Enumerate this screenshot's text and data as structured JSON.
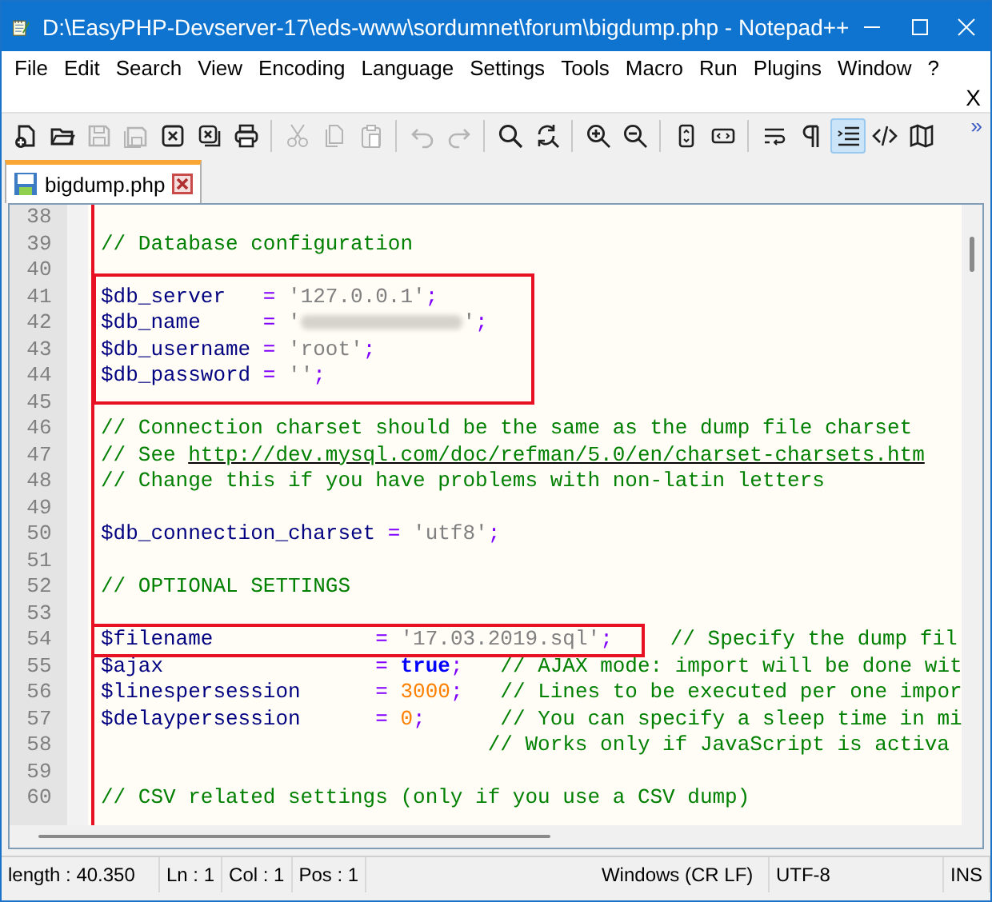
{
  "window": {
    "title": "D:\\EasyPHP-Devserver-17\\eds-www\\sordumnet\\forum\\bigdump.php - Notepad++"
  },
  "menu": [
    {
      "label": "File"
    },
    {
      "label": "Edit"
    },
    {
      "label": "Search"
    },
    {
      "label": "View"
    },
    {
      "label": "Encoding"
    },
    {
      "label": "Language"
    },
    {
      "label": "Settings"
    },
    {
      "label": "Tools"
    },
    {
      "label": "Macro"
    },
    {
      "label": "Run"
    },
    {
      "label": "Plugins"
    },
    {
      "label": "Window"
    },
    {
      "label": "?"
    }
  ],
  "close_document": "X",
  "toolbar": [
    {
      "kind": "button",
      "disabled": false,
      "selected": false
    },
    {
      "kind": "button",
      "disabled": false,
      "selected": false
    },
    {
      "kind": "button",
      "disabled": true,
      "selected": false
    },
    {
      "kind": "button",
      "disabled": true,
      "selected": false
    },
    {
      "kind": "button",
      "disabled": false,
      "selected": false
    },
    {
      "kind": "button",
      "disabled": false,
      "selected": false
    },
    {
      "kind": "button",
      "disabled": false,
      "selected": false
    },
    {
      "kind": "separator"
    },
    {
      "kind": "button",
      "disabled": true,
      "selected": false
    },
    {
      "kind": "button",
      "disabled": true,
      "selected": false
    },
    {
      "kind": "button",
      "disabled": true,
      "selected": false
    },
    {
      "kind": "separator"
    },
    {
      "kind": "button",
      "disabled": true,
      "selected": false
    },
    {
      "kind": "button",
      "disabled": true,
      "selected": false
    },
    {
      "kind": "separator"
    },
    {
      "kind": "button",
      "disabled": false,
      "selected": false
    },
    {
      "kind": "button",
      "disabled": false,
      "selected": false
    },
    {
      "kind": "separator"
    },
    {
      "kind": "button",
      "disabled": false,
      "selected": false
    },
    {
      "kind": "button",
      "disabled": false,
      "selected": false
    },
    {
      "kind": "separator"
    },
    {
      "kind": "button",
      "disabled": false,
      "selected": false
    },
    {
      "kind": "button",
      "disabled": false,
      "selected": false
    },
    {
      "kind": "separator"
    },
    {
      "kind": "button",
      "disabled": false,
      "selected": false
    },
    {
      "kind": "button",
      "disabled": false,
      "selected": false
    },
    {
      "kind": "button",
      "disabled": false,
      "selected": true
    },
    {
      "kind": "button",
      "disabled": false,
      "selected": false
    },
    {
      "kind": "button",
      "disabled": false,
      "selected": false
    }
  ],
  "toolbar_overflow": "»",
  "tabs": [
    {
      "label": "bigdump.php",
      "selected": true
    }
  ],
  "editor": {
    "lines": [
      {
        "n": "38",
        "boxed": false
      },
      {
        "n": "39",
        "boxed": false,
        "tokens": [
          {
            "kind": "comment",
            "text": "// Database configuration"
          }
        ]
      },
      {
        "n": "40",
        "boxed": false
      },
      {
        "n": "41",
        "boxed": true,
        "tokens": [
          {
            "kind": "var",
            "text": "$db_server   "
          },
          {
            "kind": "op",
            "text": "= "
          },
          {
            "kind": "string",
            "text": "'127.0.0.1'"
          },
          {
            "kind": "op",
            "text": ";"
          }
        ]
      },
      {
        "n": "42",
        "boxed": true,
        "tokens": [
          {
            "kind": "var",
            "text": "$db_name     "
          },
          {
            "kind": "op",
            "text": "= "
          },
          {
            "kind": "string",
            "text": "'"
          },
          {
            "kind": "redacted"
          },
          {
            "kind": "string",
            "text": "'"
          },
          {
            "kind": "op",
            "text": ";"
          }
        ]
      },
      {
        "n": "43",
        "boxed": true,
        "tokens": [
          {
            "kind": "var",
            "text": "$db_username "
          },
          {
            "kind": "op",
            "text": "= "
          },
          {
            "kind": "string",
            "text": "'root'"
          },
          {
            "kind": "op",
            "text": ";"
          }
        ]
      },
      {
        "n": "44",
        "boxed": true,
        "tokens": [
          {
            "kind": "var",
            "text": "$db_password "
          },
          {
            "kind": "op",
            "text": "= "
          },
          {
            "kind": "string",
            "text": "''"
          },
          {
            "kind": "op",
            "text": ";"
          }
        ]
      },
      {
        "n": "45",
        "boxed": false
      },
      {
        "n": "46",
        "boxed": false,
        "tokens": [
          {
            "kind": "comment",
            "text": "// Connection charset should be the same as the dump file charset"
          }
        ]
      },
      {
        "n": "47",
        "boxed": false,
        "tokens": [
          {
            "kind": "comment",
            "text": "// See "
          },
          {
            "kind": "link",
            "text": "http://dev.mysql.com/doc/refman/5.0/en/charset-charsets.htm"
          }
        ]
      },
      {
        "n": "48",
        "boxed": false,
        "tokens": [
          {
            "kind": "comment",
            "text": "// Change this if you have problems with non-latin letters"
          }
        ]
      },
      {
        "n": "49",
        "boxed": false
      },
      {
        "n": "50",
        "boxed": false,
        "tokens": [
          {
            "kind": "var",
            "text": "$db_connection_charset "
          },
          {
            "kind": "op",
            "text": "= "
          },
          {
            "kind": "string",
            "text": "'utf8'"
          },
          {
            "kind": "op",
            "text": ";"
          }
        ]
      },
      {
        "n": "51",
        "boxed": false
      },
      {
        "n": "52",
        "boxed": false,
        "tokens": [
          {
            "kind": "comment",
            "text": "// OPTIONAL SETTINGS"
          }
        ]
      },
      {
        "n": "53",
        "boxed": false
      },
      {
        "n": "54",
        "boxed": true,
        "tokens": [
          {
            "kind": "var",
            "text": "$filename             "
          },
          {
            "kind": "op",
            "text": "= "
          },
          {
            "kind": "string",
            "text": "'17.03.2019.sql'"
          },
          {
            "kind": "op",
            "text": ";"
          }
        ],
        "after": [
          {
            "kind": "comment",
            "text": "// Specify the dump fil"
          }
        ]
      },
      {
        "n": "55",
        "boxed": false,
        "tokens": [
          {
            "kind": "var",
            "text": "$ajax                 "
          },
          {
            "kind": "op",
            "text": "= "
          },
          {
            "kind": "keyword",
            "text": "true"
          },
          {
            "kind": "op",
            "text": ";  "
          },
          {
            "kind": "comment",
            "text": " // AJAX mode: import will be done wit"
          }
        ]
      },
      {
        "n": "56",
        "boxed": false,
        "tokens": [
          {
            "kind": "var",
            "text": "$linespersession      "
          },
          {
            "kind": "op",
            "text": "= "
          },
          {
            "kind": "number",
            "text": "3000"
          },
          {
            "kind": "op",
            "text": ";  "
          },
          {
            "kind": "comment",
            "text": " // Lines to be executed per one impor"
          }
        ]
      },
      {
        "n": "57",
        "boxed": false,
        "tokens": [
          {
            "kind": "var",
            "text": "$delaypersession      "
          },
          {
            "kind": "op",
            "text": "= "
          },
          {
            "kind": "number",
            "text": "0"
          },
          {
            "kind": "op",
            "text": ";     "
          },
          {
            "kind": "comment",
            "text": " // You can specify a sleep time in mi"
          }
        ]
      },
      {
        "n": "58",
        "boxed": false,
        "tokens": [
          {
            "kind": "comment",
            "text": "                               // Works only if JavaScript is activa"
          }
        ]
      },
      {
        "n": "59",
        "boxed": false
      },
      {
        "n": "60",
        "boxed": false,
        "tokens": [
          {
            "kind": "comment",
            "text": "// CSV related settings (only if you use a CSV dump)"
          }
        ]
      }
    ]
  },
  "status_bar": [
    {
      "text": "length : 40.350"
    },
    {
      "text": "Ln : 1"
    },
    {
      "text": "Col : 1"
    },
    {
      "text": "Pos : 1"
    },
    {
      "text": "Windows (CR LF)"
    },
    {
      "text": "UTF-8"
    },
    {
      "text": "INS"
    }
  ]
}
